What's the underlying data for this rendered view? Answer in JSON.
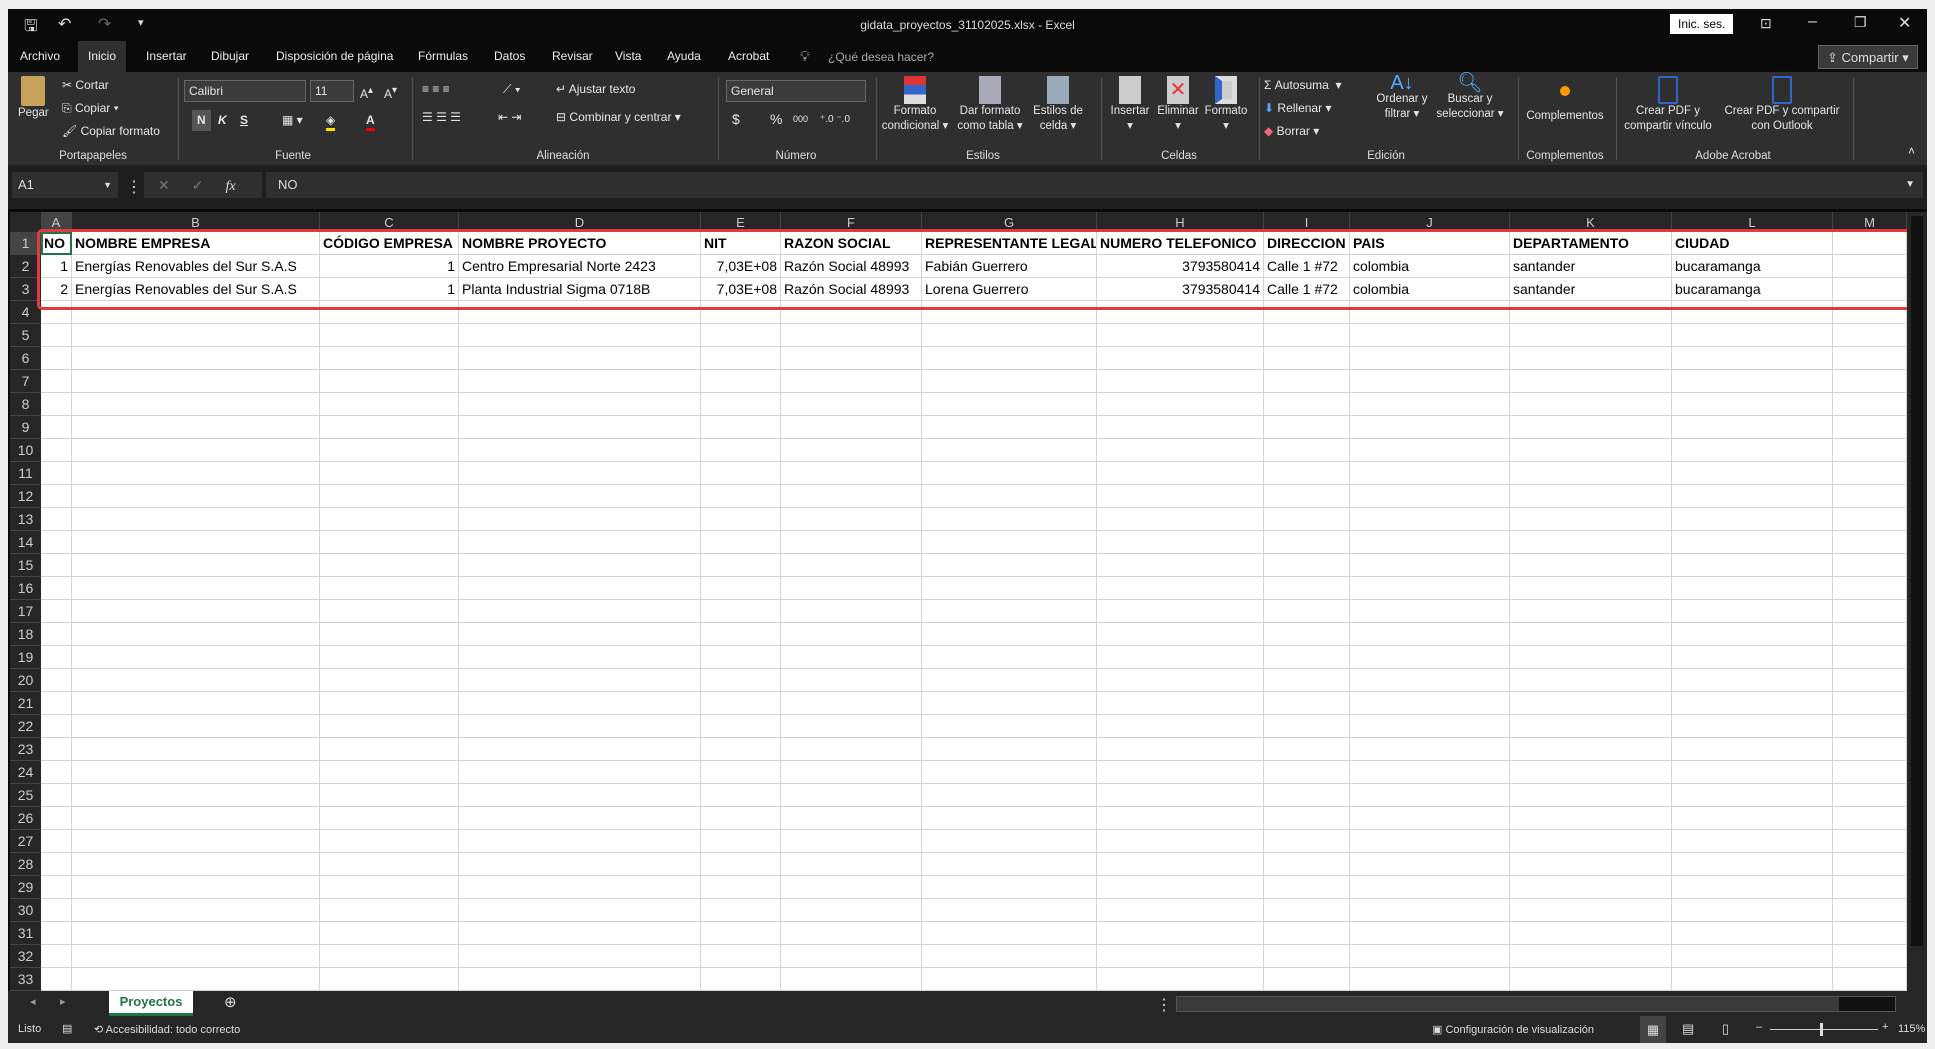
{
  "title": "gidata_proyectos_31102025.xlsx  -  Excel",
  "signin": "Inic. ses.",
  "tabs": [
    "Archivo",
    "Inicio",
    "Insertar",
    "Dibujar",
    "Disposición de página",
    "Fórmulas",
    "Datos",
    "Revisar",
    "Vista",
    "Ayuda",
    "Acrobat"
  ],
  "tell_me": "¿Qué desea hacer?",
  "share": "Compartir",
  "ribbon": {
    "clipboard": {
      "paste": "Pegar",
      "cut": "Cortar",
      "copy": "Copiar",
      "format_painter": "Copiar formato",
      "label": "Portapapeles"
    },
    "font": {
      "name": "Calibri",
      "size": "11",
      "bold": "N",
      "italic": "K",
      "underline": "S",
      "label": "Fuente"
    },
    "alignment": {
      "wrap": "Ajustar texto",
      "merge": "Combinar y centrar",
      "label": "Alineación"
    },
    "number": {
      "format": "General",
      "currency": "$",
      "percent": "%",
      "thousands": "000",
      "label": "Número"
    },
    "styles": {
      "conditional": [
        "Formato",
        "condicional"
      ],
      "table": [
        "Dar formato",
        "como tabla"
      ],
      "cell": [
        "Estilos de",
        "celda"
      ],
      "label": "Estilos"
    },
    "cells": {
      "insert": "Insertar",
      "delete": "Eliminar",
      "format": "Formato",
      "label": "Celdas"
    },
    "editing": {
      "autosum": "Autosuma",
      "fill": "Rellenar",
      "clear": "Borrar",
      "sort": [
        "Ordenar y",
        "filtrar"
      ],
      "find": [
        "Buscar y",
        "seleccionar"
      ],
      "label": "Edición"
    },
    "addins": {
      "addins": "Complementos",
      "label": "Complementos"
    },
    "acrobat": {
      "pdf_link": [
        "Crear PDF y",
        "compartir vínculo"
      ],
      "pdf_outlook": [
        "Crear PDF y compartir",
        "con Outlook"
      ],
      "label": "Adobe Acrobat"
    }
  },
  "name_box": "A1",
  "formula": "NO",
  "columns": [
    "A",
    "B",
    "C",
    "D",
    "E",
    "F",
    "G",
    "H",
    "I",
    "J",
    "K",
    "L",
    "M"
  ],
  "headers": [
    "NO",
    "NOMBRE EMPRESA",
    "CÓDIGO EMPRESA",
    "NOMBRE PROYECTO",
    "NIT",
    "RAZON SOCIAL",
    "REPRESENTANTE LEGAL",
    "NUMERO TELEFONICO",
    "DIRECCION",
    "PAIS",
    "DEPARTAMENTO",
    "CIUDAD"
  ],
  "rows": [
    [
      "1",
      "Energías Renovables del Sur S.A.S",
      "1",
      "Centro Empresarial Norte 2423",
      "7,03E+08",
      "Razón Social 48993",
      "Fabián Guerrero",
      "3793580414",
      "Calle 1 #72",
      "colombia",
      "santander",
      "bucaramanga"
    ],
    [
      "2",
      "Energías Renovables del Sur S.A.S",
      "1",
      "Planta Industrial Sigma 0718B",
      "7,03E+08",
      "Razón Social 48993",
      "Lorena Guerrero",
      "3793580414",
      "Calle 1 #72",
      "colombia",
      "santander",
      "bucaramanga"
    ]
  ],
  "sheet_tab": "Proyectos",
  "status": {
    "ready": "Listo",
    "accessibility": "Accesibilidad: todo correcto",
    "display_settings": "Configuración de visualización",
    "zoom": "115%"
  },
  "colors": {
    "accent_green": "#217346",
    "highlight_red": "#e03a3e"
  }
}
